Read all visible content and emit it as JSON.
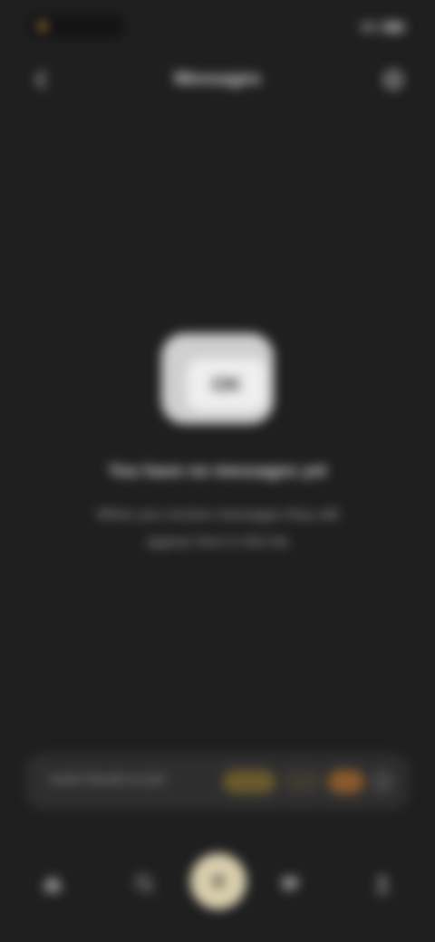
{
  "status_bar": {
    "time": "",
    "battery": ""
  },
  "header": {
    "title": "Messages",
    "back_icon": "back-icon",
    "settings_icon": "settings-icon"
  },
  "empty_state": {
    "icon": "chat-card-icon",
    "icon_label": "OK",
    "title": "You have no messages yet",
    "description": "When you receive messages they will appear here in this list"
  },
  "promo": {
    "text": "Invite friends to join"
  },
  "bottom_nav": {
    "items": [
      {
        "name": "home",
        "icon": "home-icon"
      },
      {
        "name": "search",
        "icon": "search-icon"
      },
      {
        "name": "create",
        "icon": "plus-icon"
      },
      {
        "name": "messages",
        "icon": "chat-icon"
      },
      {
        "name": "profile",
        "icon": "user-icon"
      }
    ]
  },
  "colors": {
    "background": "#1f1f20",
    "accent": "#d9cfae",
    "status_dot": "#b7863a"
  }
}
